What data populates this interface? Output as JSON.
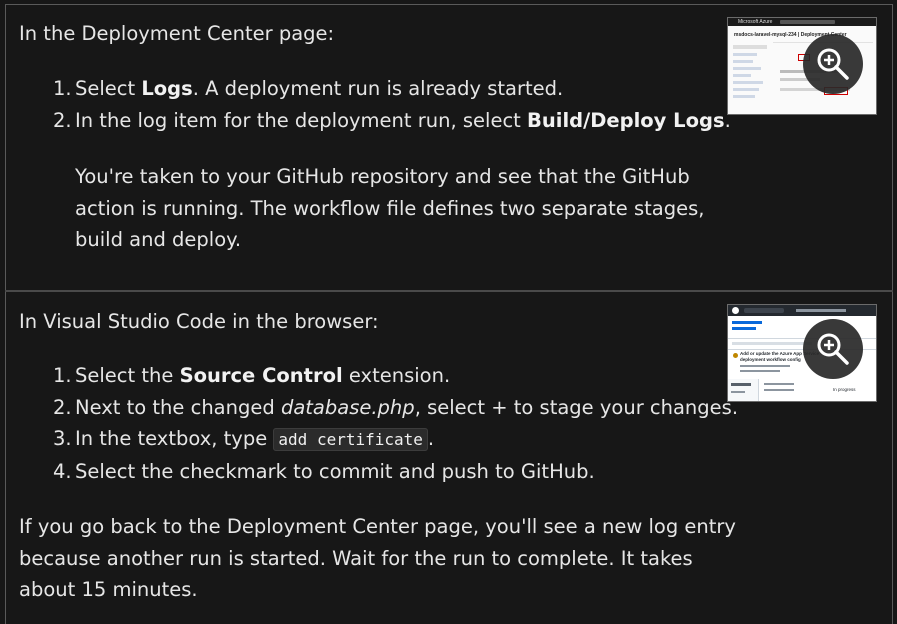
{
  "section1": {
    "intro": "In the Deployment Center page:",
    "steps": [
      {
        "num": "1.",
        "pre": "Select ",
        "bold": "Logs",
        "post": ". A deployment run is already started."
      },
      {
        "num": "2.",
        "pre": "In the log item for the deployment run, select ",
        "bold": "Build/Deploy Logs",
        "post": "."
      }
    ],
    "note_lines": [
      "You're taken to your GitHub repository and see that the GitHub",
      "action is running. The workflow file defines two separate stages,",
      "build and deploy."
    ],
    "thumb_header": "Microsoft Azure",
    "thumb_title": "msdocs-laravel-mysql-234 | Deployment Center"
  },
  "section2": {
    "intro": "In Visual Studio Code in the browser:",
    "step1": {
      "num": "1.",
      "pre": "Select the ",
      "bold": "Source Control",
      "post": " extension."
    },
    "step2": {
      "num": "2.",
      "pre": "Next to the changed ",
      "italic": "database.php",
      "post": ", select + to stage your changes."
    },
    "step3": {
      "num": "3.",
      "pre": "In the textbox, type ",
      "code": "add certificate",
      "post": "."
    },
    "step4": {
      "num": "4.",
      "text": "Select the checkmark to commit and push to GitHub."
    },
    "outro_lines": [
      "If you go back to the Deployment Center page, you'll see a new log entry",
      "because another run is started. Wait for the run to complete. It takes",
      "about 15 minutes."
    ],
    "thumb_title": "Add or update the Azure App Service deployment workflow config",
    "thumb_status": "In progress"
  },
  "colors": {
    "background": "#171717",
    "text": "#e6e6e6",
    "border": "#5a5a5a"
  },
  "icons": [
    "zoom-in-icon"
  ]
}
